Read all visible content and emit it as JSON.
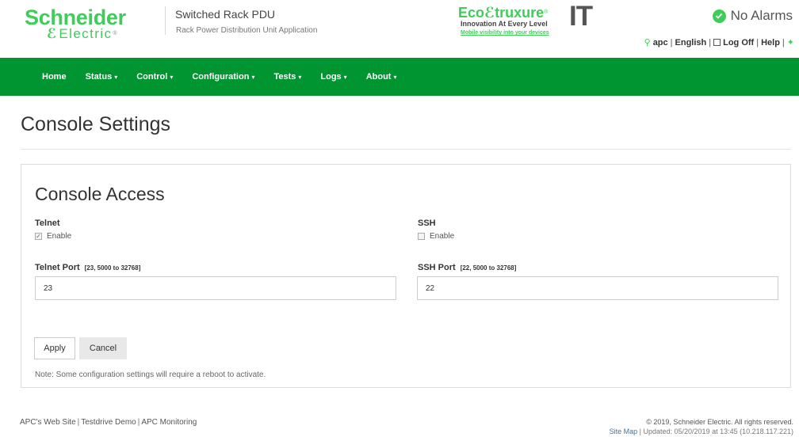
{
  "header": {
    "brand_name": "Schneider",
    "brand_sub": "Electric",
    "product_name": "Switched Rack PDU",
    "app_name": "Rack Power Distribution Unit Application",
    "eco": {
      "title_prefix": "Eco",
      "title_suffix": "truxure",
      "it": "IT",
      "tagline": "Innovation At Every Level",
      "link": "Mobile visibility into your devices"
    },
    "alarm_text": "No Alarms",
    "user": "apc",
    "language": "English",
    "logoff": "Log Off",
    "help": "Help"
  },
  "nav": {
    "items": [
      {
        "label": "Home",
        "caret": ""
      },
      {
        "label": "Status",
        "caret": "▾"
      },
      {
        "label": "Control",
        "caret": "▾"
      },
      {
        "label": "Configuration",
        "caret": "▾"
      },
      {
        "label": "Tests",
        "caret": "▾"
      },
      {
        "label": "Logs",
        "caret": "▾"
      },
      {
        "label": "About",
        "caret": "▾"
      }
    ]
  },
  "page": {
    "title": "Console Settings"
  },
  "panel": {
    "title": "Console Access",
    "telnet": {
      "label": "Telnet",
      "enable_label": "Enable",
      "enabled": true,
      "port_label": "Telnet Port",
      "port_range": "[23, 5000 to 32768]",
      "port_value": "23"
    },
    "ssh": {
      "label": "SSH",
      "enable_label": "Enable",
      "enabled": false,
      "port_label": "SSH Port",
      "port_range": "[22, 5000 to 32768]",
      "port_value": "22"
    },
    "apply_label": "Apply",
    "cancel_label": "Cancel",
    "note": "Note: Some configuration settings will require a reboot to activate."
  },
  "footer": {
    "links": [
      "APC's Web Site",
      "Testdrive Demo",
      "APC Monitoring"
    ],
    "copyright": "© 2019, Schneider Electric. All rights reserved.",
    "site_map": "Site Map",
    "updated": "Updated: 05/20/2019 at 13:45 (10.218.117.221)"
  },
  "colors": {
    "brand_green": "#3dcd58",
    "nav_green": "#009530"
  }
}
